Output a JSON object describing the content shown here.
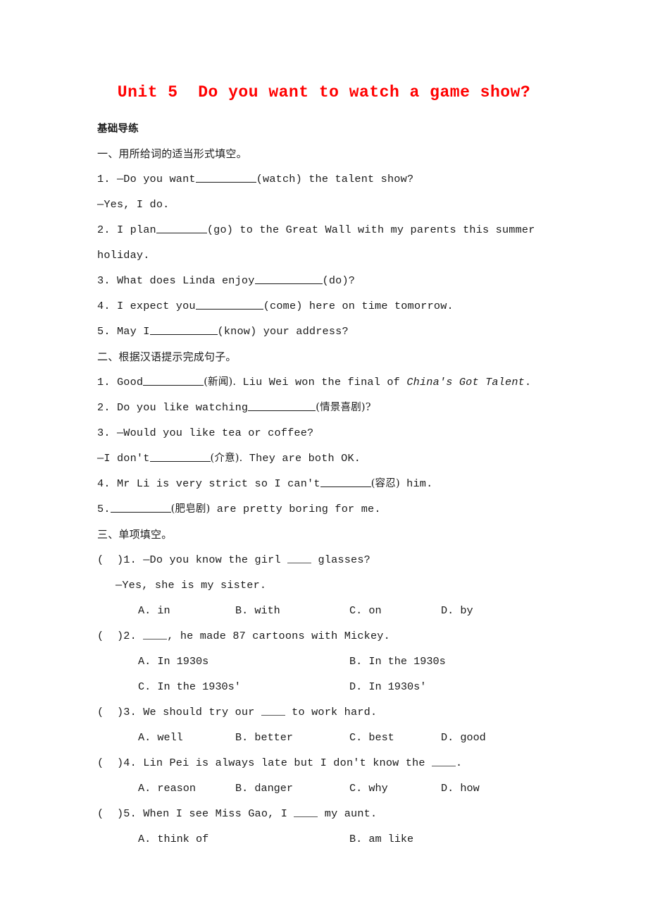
{
  "document": {
    "title": "Unit 5  Do you want to watch a game show?",
    "title_color": "#ff0000",
    "section_header": "基础导练"
  },
  "section_one": {
    "heading": "一、用所给词的适当形式填空。",
    "items": [
      {
        "prefix": "1. —Do you want",
        "hint": "(watch) the talent show?"
      },
      {
        "text": "—Yes, I do."
      },
      {
        "prefix": "2. I plan",
        "hint": "(go) to the Great Wall with my parents this summer holiday."
      },
      {
        "prefix": "3. What does Linda enjoy",
        "hint": "(do)?"
      },
      {
        "prefix": "4. I expect you",
        "hint": "(come) here on time tomorrow."
      },
      {
        "prefix": "5. May I",
        "hint": "(know) your address?"
      }
    ]
  },
  "section_two": {
    "heading": "二、根据汉语提示完成句子。",
    "items": [
      {
        "prefix": "1. Good",
        "hint_cjk": "(新闻).",
        "tail": " Liu Wei won the final of ",
        "italic": "China's Got Talent",
        "end": "."
      },
      {
        "prefix": "2. Do you like watching",
        "hint_cjk": "(情景喜剧)?"
      },
      {
        "text": "3. —Would you like tea or coffee?"
      },
      {
        "prefix": "—I don't",
        "hint_cjk": "(介意).",
        "tail": " They are both OK."
      },
      {
        "prefix": "4. Mr Li is very strict so I can't",
        "hint_cjk": "(容忍)",
        "tail": " him."
      },
      {
        "prefix": "5.",
        "hint_cjk": "(肥皂剧)",
        "tail": " are pretty boring for me."
      }
    ]
  },
  "section_three": {
    "heading": "三、单项填空。",
    "questions": [
      {
        "marker": "(  )1.",
        "stem_before": " —Do you know the girl ",
        "stem_after": " glasses?",
        "second_line": "—Yes, she is my sister.",
        "layout": "four-col",
        "options": [
          "A. in",
          "B. with",
          "C. on",
          "D. by"
        ]
      },
      {
        "marker": "(  )2.",
        "stem_before": " ",
        "stem_after": ", he made 87 cartoons with Mickey.",
        "layout": "two-col",
        "options": [
          "A. In 1930s",
          "B. In the 1930s",
          "C. In the 1930s'",
          "D. In 1930s'"
        ]
      },
      {
        "marker": "(  )3.",
        "stem_before": " We should try our ",
        "stem_after": " to work hard.",
        "layout": "four-col",
        "options": [
          "A. well",
          "B. better",
          "C. best",
          "D. good"
        ]
      },
      {
        "marker": "(  )4.",
        "stem_before": " Lin Pei is always late but I don't know the ",
        "stem_after": ".",
        "layout": "four-col",
        "options": [
          "A. reason",
          "B. danger",
          "C. why",
          "D. how"
        ]
      },
      {
        "marker": "(  )5.",
        "stem_before": " When I see Miss Gao, I ",
        "stem_after": " my aunt.",
        "layout": "two-col-partial",
        "options": [
          "A. think of",
          "B. am like"
        ]
      }
    ]
  }
}
